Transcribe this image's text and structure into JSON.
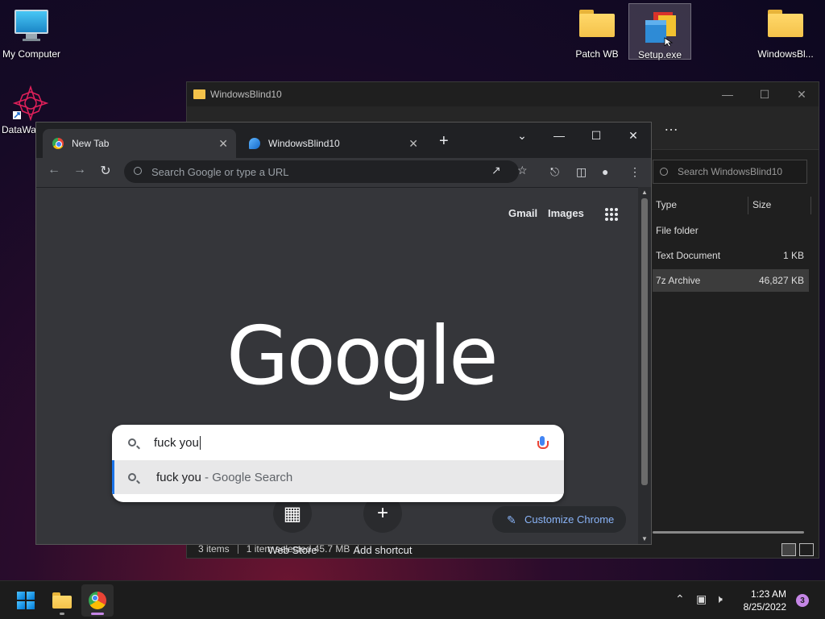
{
  "desktop": {
    "icons": [
      {
        "label": "My Computer"
      },
      {
        "label": "DataWa"
      },
      {
        "label": "Patch WB"
      },
      {
        "label": "Setup.exe"
      },
      {
        "label": "WindowsBl..."
      }
    ]
  },
  "explorer": {
    "title": "WindowsBlind10",
    "more": "…",
    "search_placeholder": "Search WindowsBlind10",
    "columns": {
      "type": "Type",
      "size": "Size"
    },
    "rows": [
      {
        "type": "File folder",
        "size": ""
      },
      {
        "type": "Text Document",
        "size": "1 KB"
      },
      {
        "type": "7z Archive",
        "size": "46,827 KB"
      }
    ],
    "status": {
      "items": "3 items",
      "selected": "1 item selected  45.7 MB"
    }
  },
  "chrome": {
    "tabs": [
      {
        "label": "New Tab"
      },
      {
        "label": "WindowsBlind10"
      }
    ],
    "omnibox_placeholder": "Search Google or type a URL",
    "links": {
      "gmail": "Gmail",
      "images": "Images"
    },
    "logo": "Google",
    "search": {
      "query": "fuck you",
      "suggestion_main": "fuck you",
      "suggestion_suffix": " - Google Search"
    },
    "shortcuts": [
      {
        "label": "Web Store"
      },
      {
        "label": "Add shortcut"
      }
    ],
    "customize_label": "Customize Chrome"
  },
  "taskbar": {
    "time": "1:23 AM",
    "date": "8/25/2022",
    "notification_count": "3"
  },
  "colors": {
    "accent": "#1a73e8",
    "chrome_link": "#8ab4f8",
    "notif": "#c586e6"
  }
}
